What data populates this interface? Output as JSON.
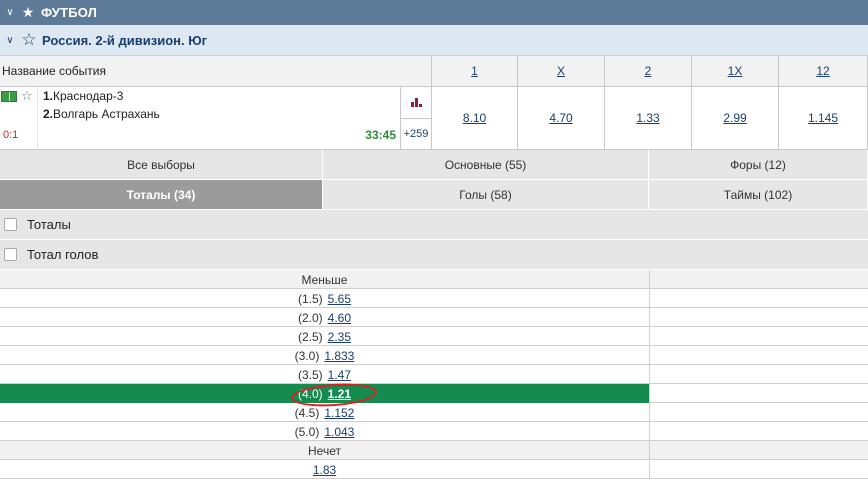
{
  "sport": {
    "title": "ФУТБОЛ"
  },
  "league": {
    "title": "Россия. 2-й дивизион. Юг"
  },
  "header": {
    "event_name_label": "Название события",
    "columns": [
      "1",
      "X",
      "2",
      "1X",
      "12"
    ]
  },
  "event": {
    "team1_num": "1.",
    "team1": "Краснодар-3",
    "team2_num": "2.",
    "team2": "Волгарь Астрахань",
    "score": "0:1",
    "time": "33:45",
    "more_markets": "+259",
    "odds": [
      "8.10",
      "4.70",
      "1.33",
      "2.99",
      "1.145"
    ]
  },
  "tabs": {
    "row1": [
      "Все выборы",
      "Основные (55)",
      "Форы (12)"
    ],
    "row2": [
      "Тоталы (34)",
      "Голы (58)",
      "Таймы (102)"
    ],
    "active": "Тоталы (34)"
  },
  "groups": [
    "Тоталы",
    "Тотал голов"
  ],
  "market": {
    "under_label": "Меньше",
    "rows": [
      {
        "param": "(1.5)",
        "odd": "5.65"
      },
      {
        "param": "(2.0)",
        "odd": "4.60"
      },
      {
        "param": "(2.5)",
        "odd": "2.35"
      },
      {
        "param": "(3.0)",
        "odd": "1.833"
      },
      {
        "param": "(3.5)",
        "odd": "1.47"
      },
      {
        "param": "(4.0)",
        "odd": "1.21"
      },
      {
        "param": "(4.5)",
        "odd": "1.152"
      },
      {
        "param": "(5.0)",
        "odd": "1.043"
      }
    ],
    "highlighted_param": "(4.0)",
    "odd_label": "Нечет",
    "odd_value": "1.83"
  },
  "colors": {
    "sport_bar": "#5e7a99",
    "league_bar": "#dde8f3",
    "highlight": "#158b4d",
    "annotation": "#e31b23",
    "link": "#1b3f6b"
  }
}
